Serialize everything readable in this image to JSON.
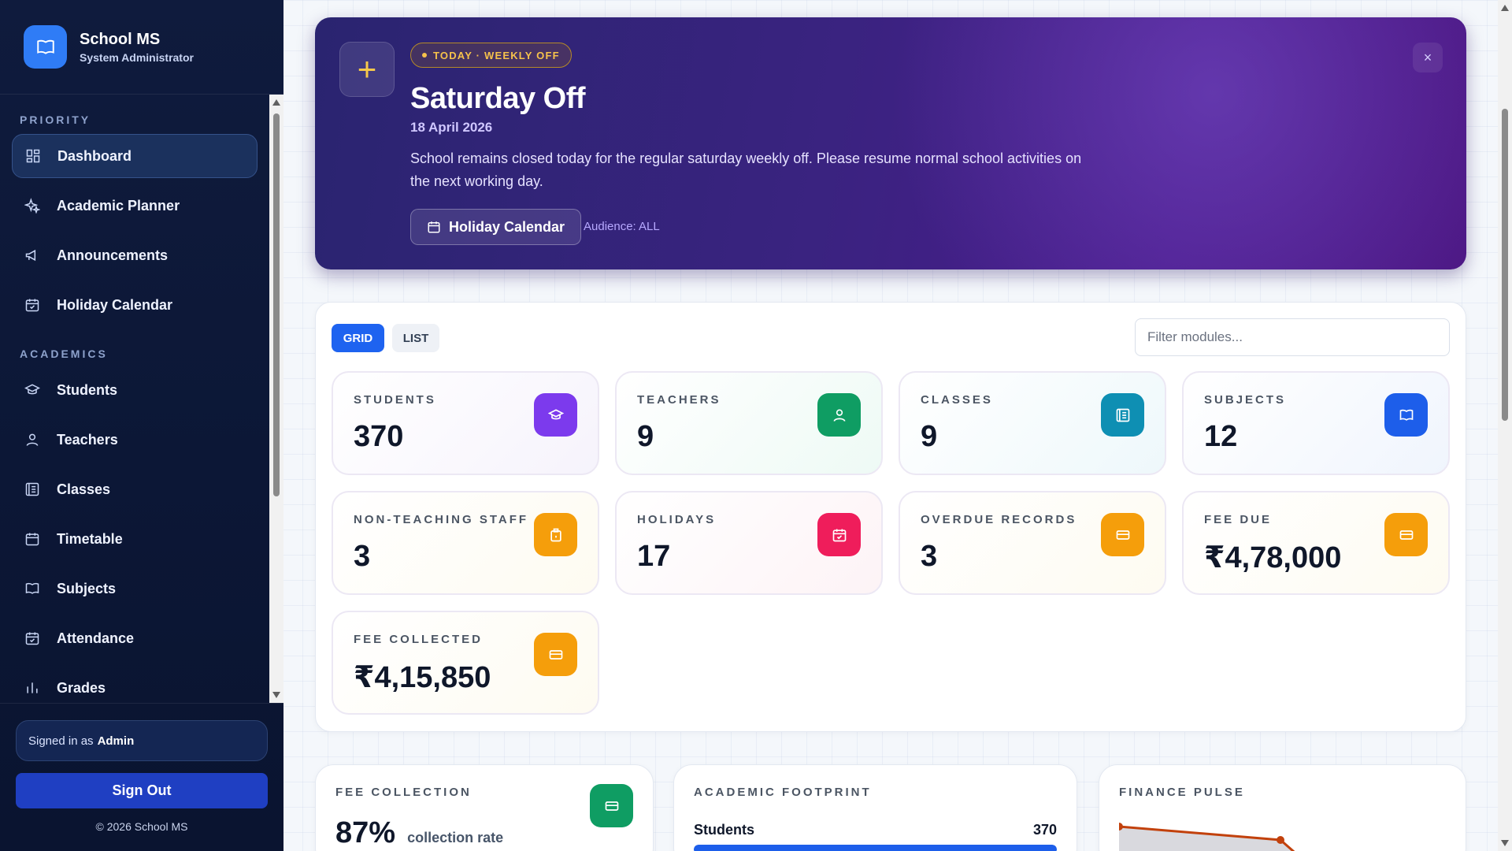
{
  "brand": {
    "title": "School MS",
    "subtitle": "System Administrator"
  },
  "sidebar": {
    "sections": [
      {
        "title": "PRIORITY",
        "items": [
          {
            "label": "Dashboard",
            "icon": "dashboard-icon",
            "active": true
          },
          {
            "label": "Academic Planner",
            "icon": "sparkle-icon"
          },
          {
            "label": "Announcements",
            "icon": "megaphone-icon"
          },
          {
            "label": "Holiday Calendar",
            "icon": "calendar-check-icon"
          }
        ]
      },
      {
        "title": "ACADEMICS",
        "items": [
          {
            "label": "Students",
            "icon": "graduation-cap-icon"
          },
          {
            "label": "Teachers",
            "icon": "user-icon"
          },
          {
            "label": "Classes",
            "icon": "list-box-icon"
          },
          {
            "label": "Timetable",
            "icon": "calendar-icon"
          },
          {
            "label": "Subjects",
            "icon": "book-icon"
          },
          {
            "label": "Attendance",
            "icon": "calendar-check-icon"
          },
          {
            "label": "Grades",
            "icon": "bar-chart-icon"
          }
        ]
      }
    ],
    "footer": {
      "signed_in_prefix": "Signed in as",
      "signed_in_user": "Admin",
      "sign_out": "Sign Out",
      "copyright": "© 2026 School MS"
    }
  },
  "banner": {
    "tag": "TODAY · WEEKLY OFF",
    "title": "Saturday Off",
    "date": "18 April 2026",
    "description": "School remains closed today for the regular saturday weekly off. Please resume normal school activities on the next working day.",
    "button": "Holiday Calendar",
    "audience": "Audience: ALL",
    "close": "×",
    "plus": "+"
  },
  "modules": {
    "view_grid": "GRID",
    "view_list": "LIST",
    "filter_placeholder": "Filter modules...",
    "cards": [
      {
        "label": "STUDENTS",
        "value": "370",
        "icon": "graduation-cap-icon",
        "color": "#7c3aed",
        "tint": "#f6f3fc"
      },
      {
        "label": "TEACHERS",
        "value": "9",
        "icon": "user-icon",
        "color": "#0f9d63",
        "tint": "#eefaf5"
      },
      {
        "label": "CLASSES",
        "value": "9",
        "icon": "list-box-icon",
        "color": "#0e8fb3",
        "tint": "#eef8fb"
      },
      {
        "label": "SUBJECTS",
        "value": "12",
        "icon": "book-icon",
        "color": "#1d5eea",
        "tint": "#f0f5fd"
      },
      {
        "label": "NON-TEACHING STAFF",
        "value": "3",
        "icon": "badge-icon",
        "color": "#f59e0b",
        "tint": "#fefbf1"
      },
      {
        "label": "HOLIDAYS",
        "value": "17",
        "icon": "calendar-check-icon",
        "color": "#ef1d5b",
        "tint": "#fdf3f6"
      },
      {
        "label": "OVERDUE RECORDS",
        "value": "3",
        "icon": "card-icon",
        "color": "#f59e0b",
        "tint": "#fefbf1"
      },
      {
        "label": "FEE DUE",
        "value": "₹4,78,000",
        "icon": "card-icon",
        "color": "#f59e0b",
        "tint": "#fefbf1"
      },
      {
        "label": "FEE COLLECTED",
        "value": "₹4,15,850",
        "icon": "card-icon",
        "color": "#f59e0b",
        "tint": "#fefbf1"
      }
    ]
  },
  "bottom": {
    "fee_collection": {
      "label": "FEE COLLECTION",
      "rate": "87%",
      "rate_caption": "collection rate",
      "icon": "card-icon",
      "color": "#0f9d63"
    },
    "academic_footprint": {
      "label": "ACADEMIC FOOTPRINT",
      "row_label": "Students",
      "row_value": "370",
      "bar_fill": 1.0,
      "bar_color": "#1d5eea"
    },
    "finance_pulse": {
      "label": "FINANCE PULSE",
      "line_color": "#c2410c"
    }
  }
}
